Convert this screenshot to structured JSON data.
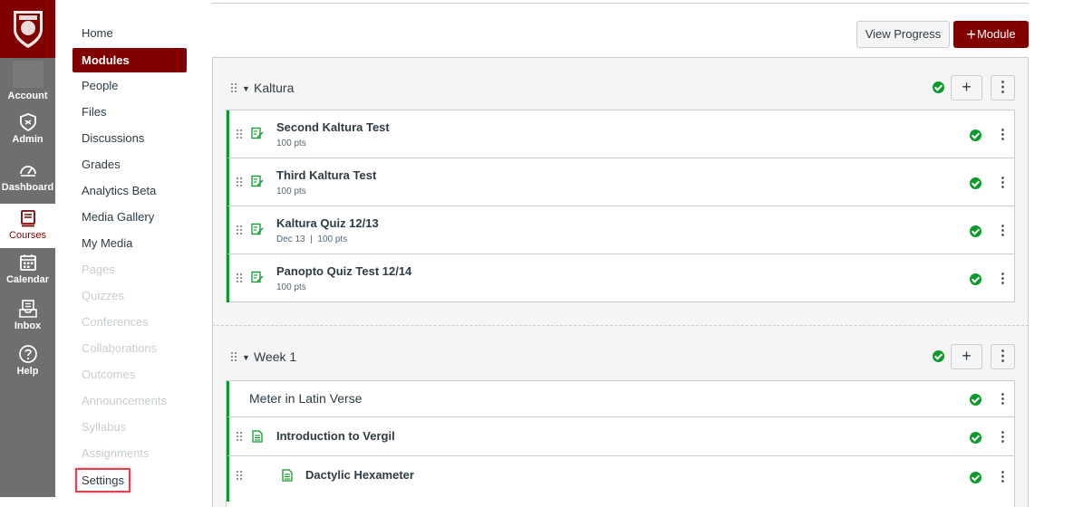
{
  "global_nav": {
    "items": [
      {
        "label": "Account",
        "icon": "account-avatar"
      },
      {
        "label": "Admin",
        "icon": "shield-icon"
      },
      {
        "label": "Dashboard",
        "icon": "dashboard-gauge-icon"
      },
      {
        "label": "Courses",
        "icon": "book-icon",
        "active": true
      },
      {
        "label": "Calendar",
        "icon": "calendar-icon"
      },
      {
        "label": "Inbox",
        "icon": "inbox-icon"
      },
      {
        "label": "Help",
        "icon": "help-icon"
      }
    ],
    "colors": {
      "brand": "#800000",
      "nav_bg": "#6f6f6f"
    }
  },
  "course_nav": {
    "items": [
      {
        "label": "Home",
        "state": "enabled"
      },
      {
        "label": "Modules",
        "state": "active"
      },
      {
        "label": "People",
        "state": "enabled"
      },
      {
        "label": "Files",
        "state": "enabled"
      },
      {
        "label": "Discussions",
        "state": "enabled"
      },
      {
        "label": "Grades",
        "state": "enabled"
      },
      {
        "label": "Analytics Beta",
        "state": "enabled"
      },
      {
        "label": "Media Gallery",
        "state": "enabled"
      },
      {
        "label": "My Media",
        "state": "enabled"
      },
      {
        "label": "Pages",
        "state": "disabled"
      },
      {
        "label": "Quizzes",
        "state": "disabled"
      },
      {
        "label": "Conferences",
        "state": "disabled"
      },
      {
        "label": "Collaborations",
        "state": "disabled"
      },
      {
        "label": "Outcomes",
        "state": "disabled"
      },
      {
        "label": "Announcements",
        "state": "disabled"
      },
      {
        "label": "Syllabus",
        "state": "disabled"
      },
      {
        "label": "Assignments",
        "state": "disabled"
      },
      {
        "label": "Settings",
        "state": "highlighted"
      }
    ]
  },
  "toolbar": {
    "view_progress_label": "View Progress",
    "add_module_plus": "+",
    "add_module_label": "Module"
  },
  "modules": [
    {
      "title": "Kaltura",
      "items": [
        {
          "title": "Second Kaltura Test",
          "meta": "100 pts",
          "icon": "quiz-icon"
        },
        {
          "title": "Third Kaltura Test",
          "meta": "100 pts",
          "icon": "quiz-icon"
        },
        {
          "title": "Kaltura Quiz 12/13",
          "meta": "Dec 13  |  100 pts",
          "icon": "quiz-icon"
        },
        {
          "title": "Panopto Quiz Test 12/14",
          "meta": "100 pts",
          "icon": "quiz-icon"
        }
      ]
    },
    {
      "title": "Week 1",
      "items": [
        {
          "title": "Meter in Latin Verse",
          "type": "subheader"
        },
        {
          "title": "Introduction to Vergil",
          "icon": "page-icon"
        },
        {
          "title": "Dactylic Hexameter",
          "icon": "page-icon",
          "indent": 1
        }
      ]
    }
  ],
  "symbols": {
    "plus": "+",
    "kebab": "⋮"
  },
  "status_color": "#0b9b2b"
}
